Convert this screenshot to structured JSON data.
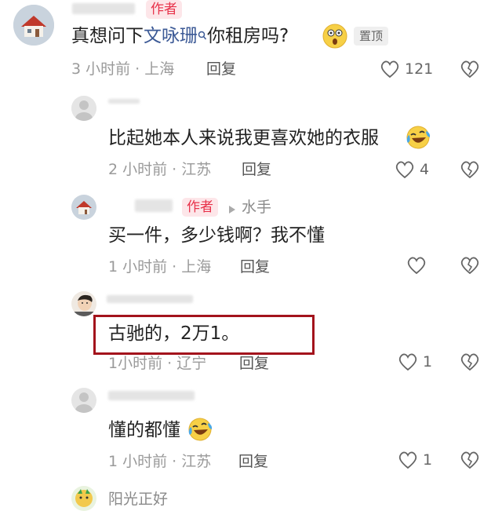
{
  "comments": [
    {
      "author_tag": "作者",
      "text_prefix": "真想问下",
      "text_link": "文咏珊",
      "text_suffix": "你租房吗?",
      "pinned_label": "置顶",
      "time": "3 小时前 · 上海",
      "reply_label": "回复",
      "likes": "121"
    },
    {
      "text": "比起她本人来说我更喜欢她的衣服",
      "time": "2 小时前 · 江苏",
      "reply_label": "回复",
      "likes": "4"
    },
    {
      "author_tag": "作者",
      "reply_to": "水手",
      "text": "买一件，多少钱啊？我不懂",
      "time": "1 小时前 · 上海",
      "reply_label": "回复"
    },
    {
      "text": "古驰的，2万1。",
      "time": "1小时前 · 辽宁",
      "reply_label": "回复",
      "likes": "1"
    },
    {
      "text": "懂的都懂",
      "time": "1 小时前 · 江苏",
      "reply_label": "回复",
      "likes": "1"
    },
    {
      "username": "阳光正好"
    }
  ],
  "icons": {
    "like": "heart-outline-icon",
    "dislike": "broken-heart-icon",
    "search": "search-icon",
    "laugh": "laughing-tears-emoji",
    "surprised": "surprised-emoji",
    "arrow": "play-arrow-icon"
  },
  "colors": {
    "author_tag_bg": "#fde6e9",
    "author_tag_text": "#e8324a",
    "link": "#3c5a96",
    "highlight_box": "#a3131c"
  }
}
